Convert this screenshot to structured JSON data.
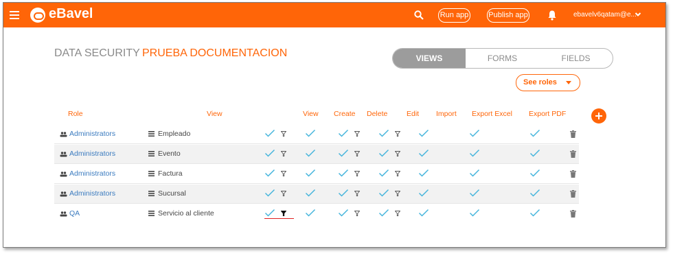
{
  "app": {
    "logo_text": "eBavel"
  },
  "header": {
    "run_app_label": "Run app",
    "publish_app_label": "Publish app",
    "user_name": "ebavelv6qatam@e..."
  },
  "page": {
    "section_title": "DATA SECURITY",
    "subtitle": "PRUEBA DOCUMENTACION"
  },
  "tabs": [
    {
      "label": "VIEWS",
      "active": true
    },
    {
      "label": "FORMS",
      "active": false
    },
    {
      "label": "FIELDS",
      "active": false
    }
  ],
  "see_roles_label": "See roles",
  "table": {
    "columns": [
      "Role",
      "View",
      "View",
      "Create",
      "Delete",
      "Edit",
      "Import",
      "Export Excel",
      "Export PDF"
    ],
    "rows": [
      {
        "role": "Administrators",
        "view": "Empleado"
      },
      {
        "role": "Administrators",
        "view": "Evento"
      },
      {
        "role": "Administrators",
        "view": "Factura"
      },
      {
        "role": "Administrators",
        "view": "Sucursal"
      },
      {
        "role": "QA",
        "view": "Servicio al cliente"
      }
    ]
  },
  "colors": {
    "accent": "#ff6508",
    "check": "#45b5dc",
    "link": "#3b7bbf",
    "underline": "#e02020"
  }
}
